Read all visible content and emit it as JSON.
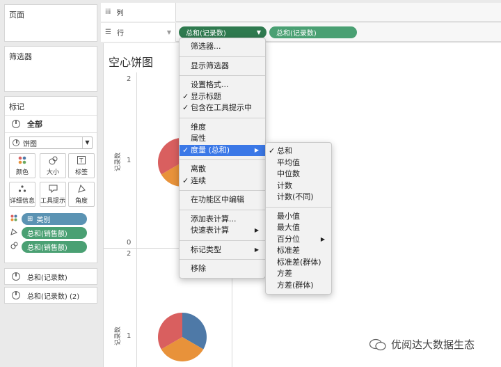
{
  "left": {
    "pages_title": "页面",
    "filters_title": "筛选器",
    "marks_title": "标记",
    "marks_all": "全部",
    "mark_type": "饼图",
    "buttons": [
      {
        "label": "颜色",
        "icon": "color-dots-icon"
      },
      {
        "label": "大小",
        "icon": "size-icon"
      },
      {
        "label": "标签",
        "icon": "label-icon"
      },
      {
        "label": "详细信息",
        "icon": "detail-icon"
      },
      {
        "label": "工具提示",
        "icon": "tooltip-icon"
      },
      {
        "label": "角度",
        "icon": "angle-icon"
      }
    ],
    "mark_pills": [
      {
        "label": "类别",
        "prefix": "⊞",
        "color": "#5b93b3"
      },
      {
        "label": "总和(销售额)",
        "color": "#4aa073"
      },
      {
        "label": "总和(销售额)",
        "color": "#4aa073"
      }
    ],
    "measures": [
      "总和(记录数)",
      "总和(记录数) (2)"
    ]
  },
  "shelves": {
    "columns_label": "列",
    "rows_label": "行",
    "row_pills": [
      "总和(记录数)",
      "总和(记录数)"
    ]
  },
  "canvas": {
    "title": "空心饼图",
    "y_label": "记录数",
    "ticks_top": [
      "2",
      "1",
      "0"
    ],
    "ticks_bottom": [
      "2",
      "1"
    ]
  },
  "context_menu": {
    "items": [
      {
        "label": "筛选器...",
        "checked": false
      },
      {
        "sep": true
      },
      {
        "label": "显示筛选器",
        "checked": false
      },
      {
        "sep": true
      },
      {
        "label": "设置格式...",
        "checked": false
      },
      {
        "label": "显示标题",
        "checked": true
      },
      {
        "label": "包含在工具提示中",
        "checked": true
      },
      {
        "sep": true
      },
      {
        "label": "维度",
        "checked": false
      },
      {
        "label": "属性",
        "checked": false
      },
      {
        "label": "度量 (总和)",
        "checked": true,
        "submenu": true,
        "highlighted": true
      },
      {
        "sep": true
      },
      {
        "label": "离散",
        "checked": false
      },
      {
        "label": "连续",
        "checked": true
      },
      {
        "sep": true
      },
      {
        "label": "在功能区中编辑",
        "checked": false
      },
      {
        "sep": true
      },
      {
        "label": "添加表计算...",
        "checked": false
      },
      {
        "label": "快速表计算",
        "checked": false,
        "submenu": true
      },
      {
        "sep": true
      },
      {
        "label": "标记类型",
        "checked": false,
        "submenu": true
      },
      {
        "sep": true
      },
      {
        "label": "移除",
        "checked": false
      }
    ]
  },
  "sub_menu": {
    "items": [
      {
        "label": "总和",
        "checked": true
      },
      {
        "label": "平均值"
      },
      {
        "label": "中位数"
      },
      {
        "label": "计数"
      },
      {
        "label": "计数(不同)"
      },
      {
        "sep": true
      },
      {
        "label": "最小值"
      },
      {
        "label": "最大值"
      },
      {
        "label": "百分位",
        "submenu": true
      },
      {
        "label": "标准差"
      },
      {
        "label": "标准差(群体)"
      },
      {
        "label": "方差"
      },
      {
        "label": "方差(群体)"
      }
    ]
  },
  "colors": {
    "pie_red": "#d95f5f",
    "pie_blue": "#4e79a7",
    "pie_orange": "#e8923a",
    "menu_highlight": "#3b78e7",
    "pill_green": "#4aa073",
    "pill_blue": "#5b93b3"
  },
  "watermark": "优阅达大数据生态"
}
